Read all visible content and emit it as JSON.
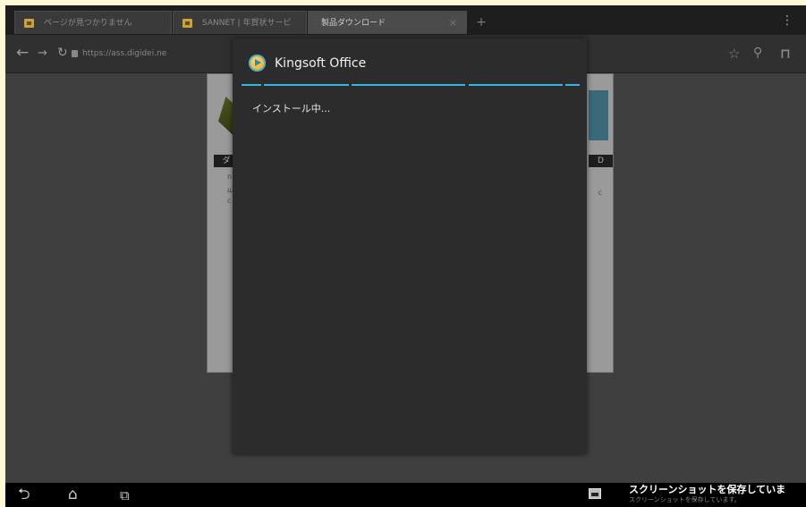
{
  "tabs": [
    {
      "label": "ページが見つかりません",
      "active": false
    },
    {
      "label": "SANNET | 年賀状サービ",
      "active": false
    },
    {
      "label": "製品ダウンロード",
      "active": true
    }
  ],
  "tab_close_glyph": "×",
  "new_tab_glyph": "+",
  "address": {
    "url": "https://ass.digidei.ne"
  },
  "page_fragments": {
    "left_banner": "ダ",
    "right_banner": "D",
    "frag_1": "n",
    "frag_2": "ш",
    "frag_3": "c",
    "frag_4": "c"
  },
  "dialog": {
    "title": "Kingsoft Office",
    "status": "インストール中..."
  },
  "notification": {
    "title": "スクリーンショットを保存していま",
    "subtitle": "スクリーンショットを保存しています。"
  },
  "icons": {
    "back": "back-arrow-icon",
    "forward": "forward-arrow-icon",
    "reload": "reload-icon",
    "bookmark_star": "star-icon",
    "search": "search-icon",
    "bookmarks": "bookmark-icon",
    "nav_back": "android-back-icon",
    "nav_home": "android-home-icon",
    "nav_recent": "android-recent-apps-icon"
  },
  "colors": {
    "accent": "#33b5e5",
    "dialog_bg": "#2c2c2c",
    "frame": "#fff9d8"
  }
}
